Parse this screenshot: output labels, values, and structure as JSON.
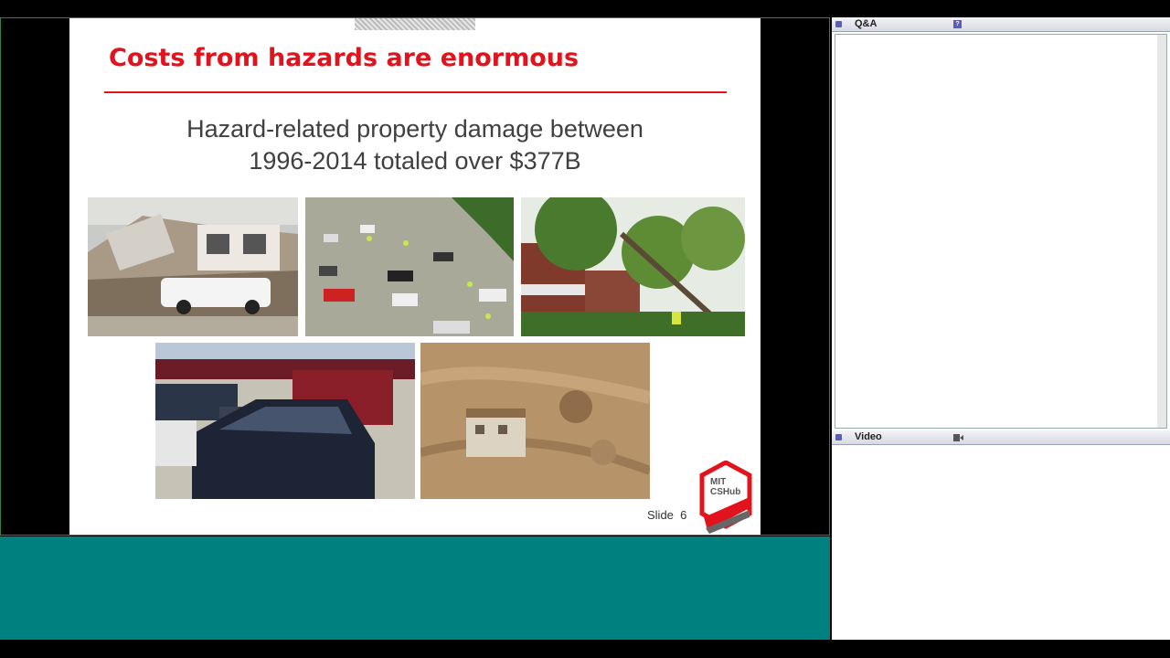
{
  "slide": {
    "title": "Costs from hazards are enormous",
    "subtitle_line1": "Hazard-related property damage between",
    "subtitle_line2": "1996-2014 totaled over $377B",
    "slide_label": "Slide",
    "slide_number": "6",
    "logo_text_1": "MIT",
    "logo_text_2": "CSHub"
  },
  "panels": {
    "qa": {
      "title": "Q&A",
      "help_icon": "help-icon"
    },
    "video": {
      "title": "Video",
      "camera_icon": "camera-icon"
    }
  },
  "colors": {
    "title_red": "#e1141e",
    "teal": "#00807f",
    "panel_accent": "#5b5fb0"
  }
}
